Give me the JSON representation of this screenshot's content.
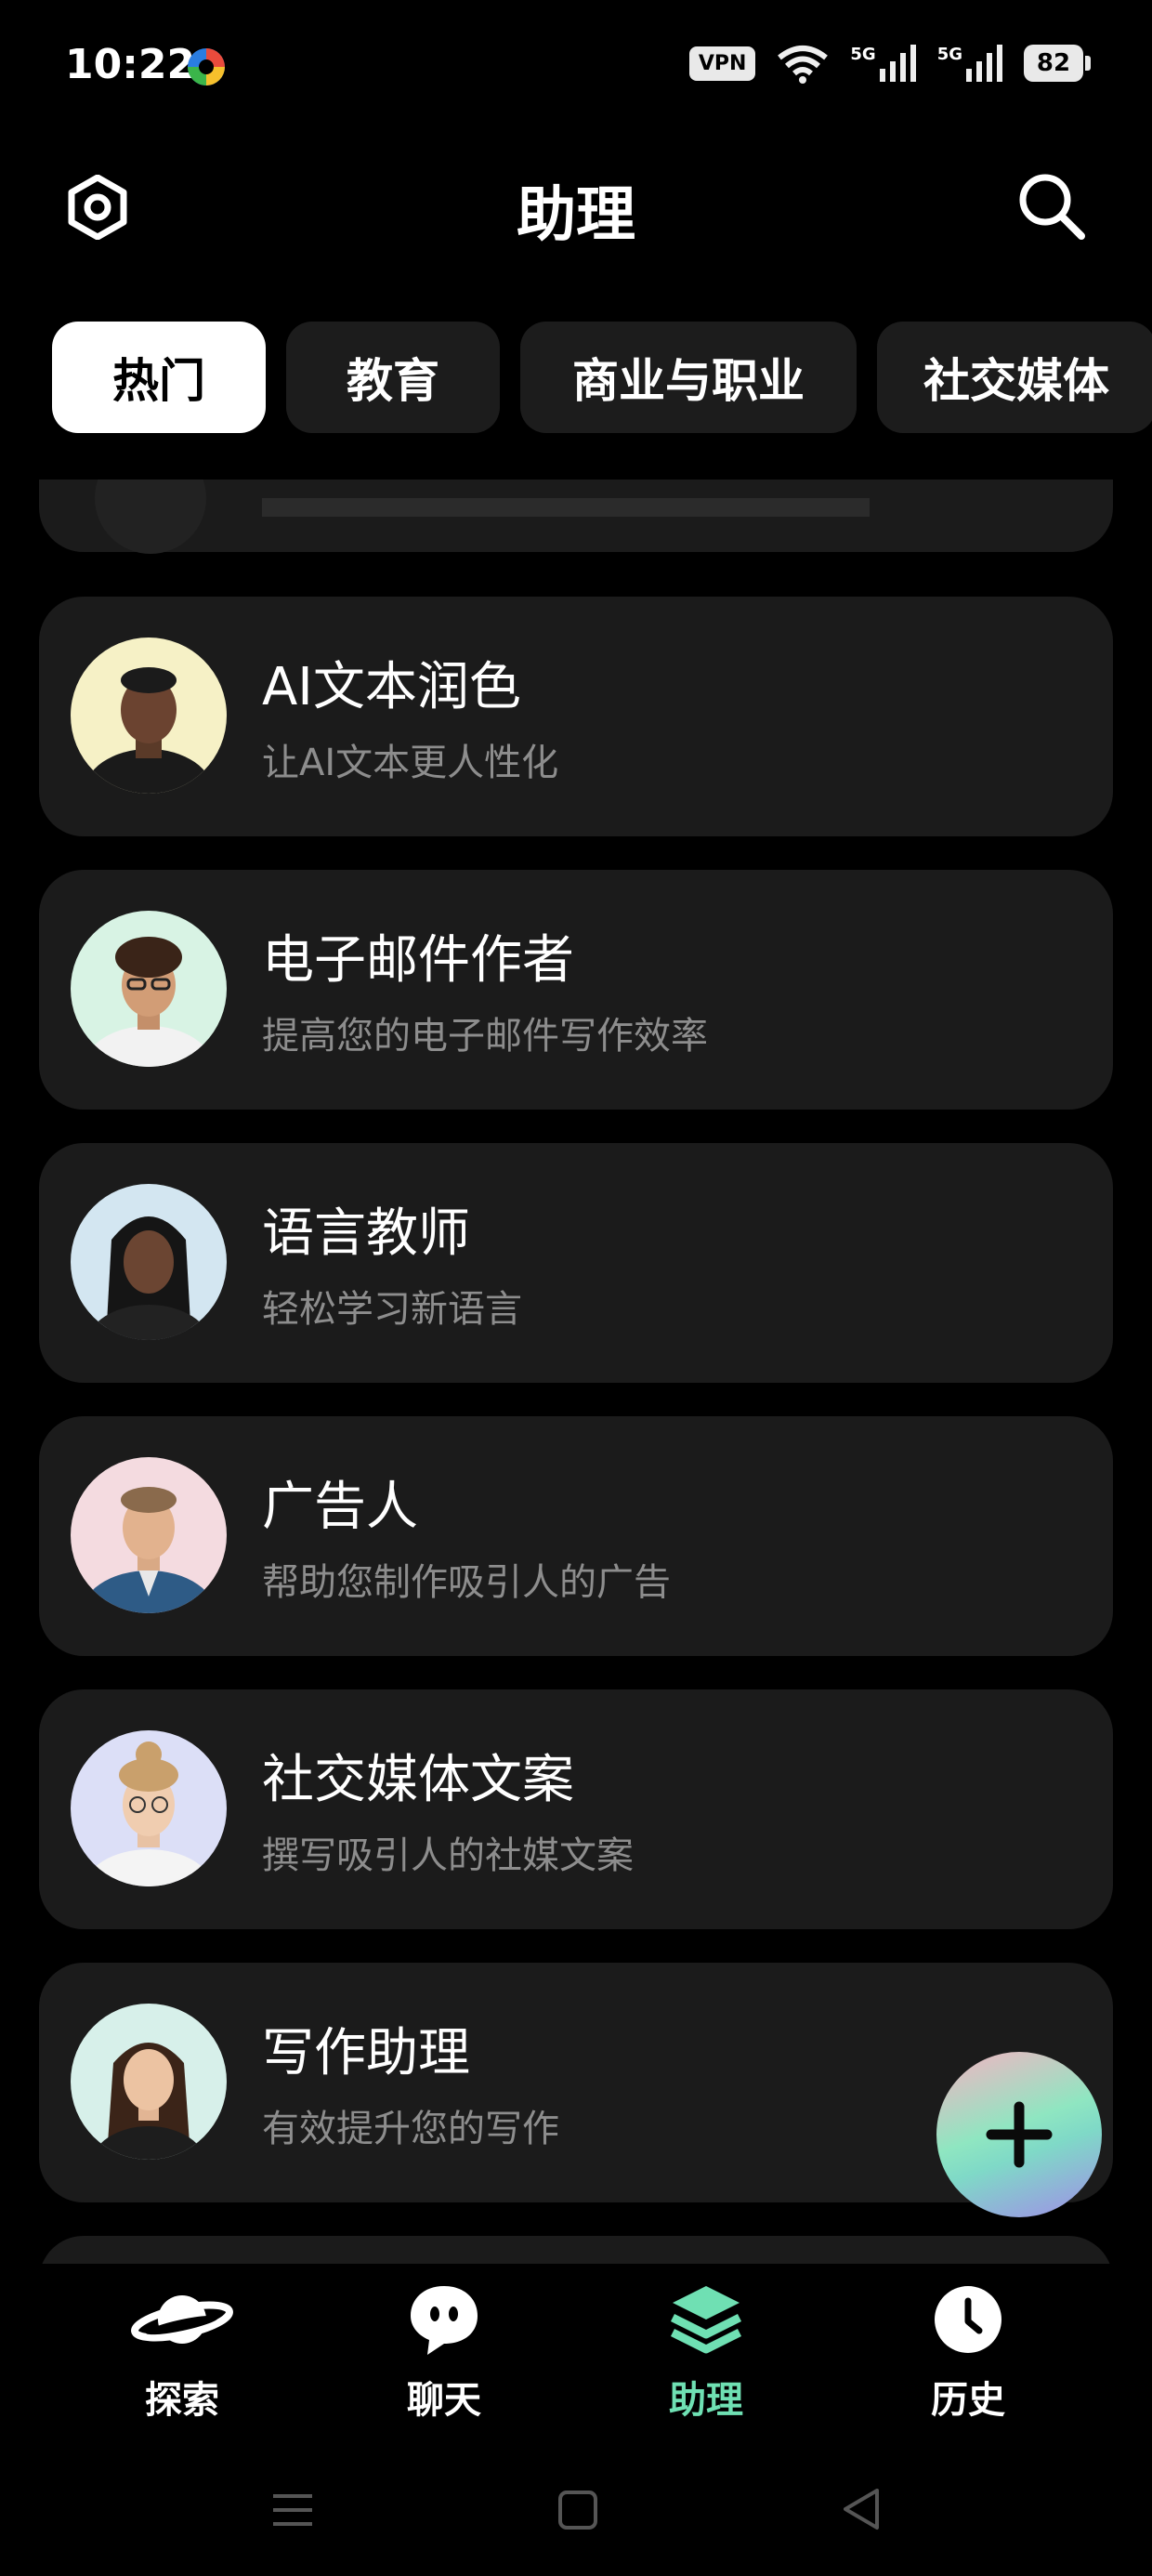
{
  "status_bar": {
    "time": "10:22",
    "vpn": "VPN",
    "network1": "5G",
    "network2": "5G",
    "battery": "82"
  },
  "header": {
    "title": "助理"
  },
  "tabs": [
    {
      "label": "热门",
      "active": true
    },
    {
      "label": "教育",
      "active": false
    },
    {
      "label": "商业与职业",
      "active": false
    },
    {
      "label": "社交媒体",
      "active": false
    }
  ],
  "assistants": [
    {
      "name": "AI文本润色",
      "description": "让AI文本更人性化",
      "avatar_bg": "#f6f1c6"
    },
    {
      "name": "电子邮件作者",
      "description": "提高您的电子邮件写作效率",
      "avatar_bg": "#d8f3e4"
    },
    {
      "name": "语言教师",
      "description": "轻松学习新语言",
      "avatar_bg": "#d3e6f1"
    },
    {
      "name": "广告人",
      "description": "帮助您制作吸引人的广告",
      "avatar_bg": "#f4dbe0"
    },
    {
      "name": "社交媒体文案",
      "description": "撰写吸引人的社媒文案",
      "avatar_bg": "#dcdff7"
    },
    {
      "name": "写作助理",
      "description": "有效提升您的写作",
      "avatar_bg": "#d7f0ea"
    }
  ],
  "nav": [
    {
      "label": "探索",
      "icon": "planet-icon",
      "active": false
    },
    {
      "label": "聊天",
      "icon": "chat-bubble-icon",
      "active": false
    },
    {
      "label": "助理",
      "icon": "layers-icon",
      "active": true
    },
    {
      "label": "历史",
      "icon": "clock-icon",
      "active": false
    }
  ],
  "colors": {
    "accent": "#6fe0b3",
    "card": "#1b1b1b",
    "background": "#000000"
  }
}
